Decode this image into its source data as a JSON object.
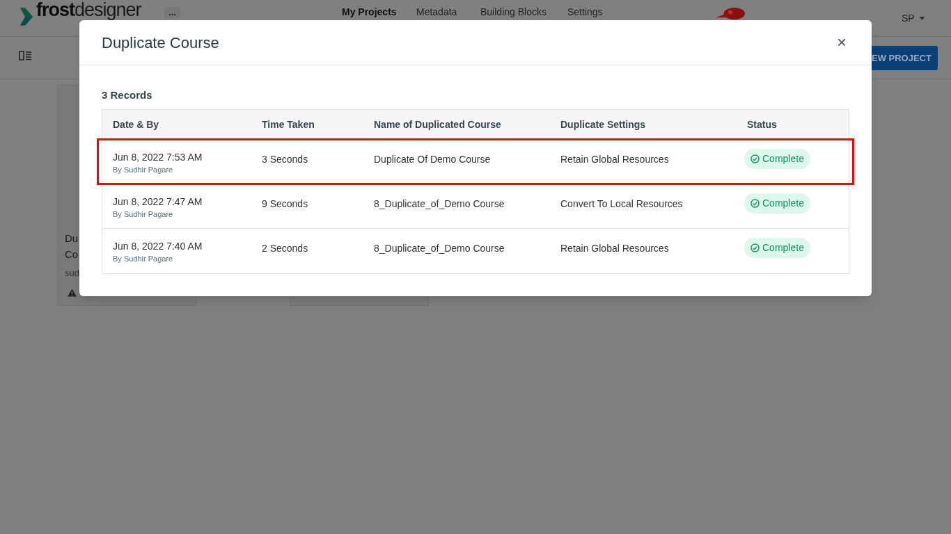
{
  "navbar": {
    "logo": {
      "bold": "frost",
      "light": "designer"
    },
    "more_button": "...",
    "links": [
      {
        "label": "My Projects",
        "selected": true
      },
      {
        "label": "Metadata",
        "selected": false
      },
      {
        "label": "Building Blocks",
        "selected": false
      },
      {
        "label": "Settings",
        "selected": false
      }
    ],
    "user": "SP"
  },
  "toolbar": {
    "new_project_button": "EW PROJECT"
  },
  "cards": [
    {
      "title_lines": [
        "Du",
        "Co"
      ],
      "author": "sud",
      "warning": true
    }
  ],
  "dialog": {
    "title": "Duplicate Course",
    "close": "×",
    "records_count": "3 Records",
    "table": {
      "columns": [
        "Date & By",
        "Time Taken",
        "Name of Duplicated Course",
        "Duplicate Settings",
        "Status"
      ],
      "rows": [
        {
          "date": "Jun 8, 2022 7:53 AM",
          "by": "By Sudhir Pagare",
          "time_taken": "3 Seconds",
          "name": "Duplicate Of Demo Course",
          "settings": "Retain Global Resources",
          "status": "Complete",
          "highlighted": true
        },
        {
          "date": "Jun 8, 2022 7:47 AM",
          "by": "By Sudhir Pagare",
          "time_taken": "9 Seconds",
          "name": "8_Duplicate_of_Demo Course",
          "settings": "Convert To Local Resources",
          "status": "Complete",
          "highlighted": false
        },
        {
          "date": "Jun 8, 2022 7:40 AM",
          "by": "By Sudhir Pagare",
          "time_taken": "2 Seconds",
          "name": "8_Duplicate_of_Demo Course",
          "settings": "Retain Global Resources",
          "status": "Complete",
          "highlighted": false
        }
      ]
    }
  }
}
